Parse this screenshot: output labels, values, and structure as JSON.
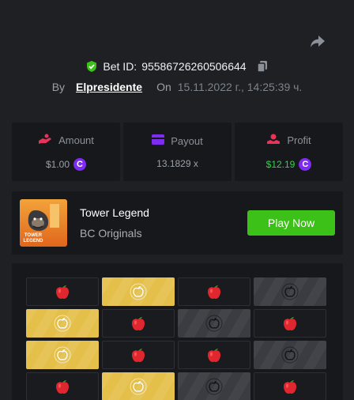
{
  "bet": {
    "id_label": "Bet ID:",
    "id": "95586726260506644",
    "by_label": "By",
    "user": "Elpresidente",
    "on_label": "On",
    "date": "15.11.2022 г., 14:25:39 ч."
  },
  "stats": {
    "amount": {
      "label": "Amount",
      "value": "$1.00",
      "coin": "C"
    },
    "payout": {
      "label": "Payout",
      "value": "13.1829 x"
    },
    "profit": {
      "label": "Profit",
      "value": "$12.19",
      "coin": "C"
    }
  },
  "game": {
    "title": "Tower Legend",
    "provider": "BC Originals",
    "thumb_label": "TOWER LEGEND",
    "play_label": "Play Now"
  },
  "board": {
    "rows": [
      [
        "apple",
        "gold",
        "apple",
        "dark"
      ],
      [
        "gold",
        "apple",
        "dark",
        "apple"
      ],
      [
        "gold",
        "apple",
        "apple",
        "dark"
      ],
      [
        "apple",
        "gold",
        "dark",
        "apple"
      ]
    ]
  },
  "colors": {
    "accent_green": "#3bc117",
    "profit_green": "#35d14a",
    "coin_purple": "#7e2cf2",
    "gold_tile": "#e4c04b",
    "apple_red": "#e0262e"
  }
}
